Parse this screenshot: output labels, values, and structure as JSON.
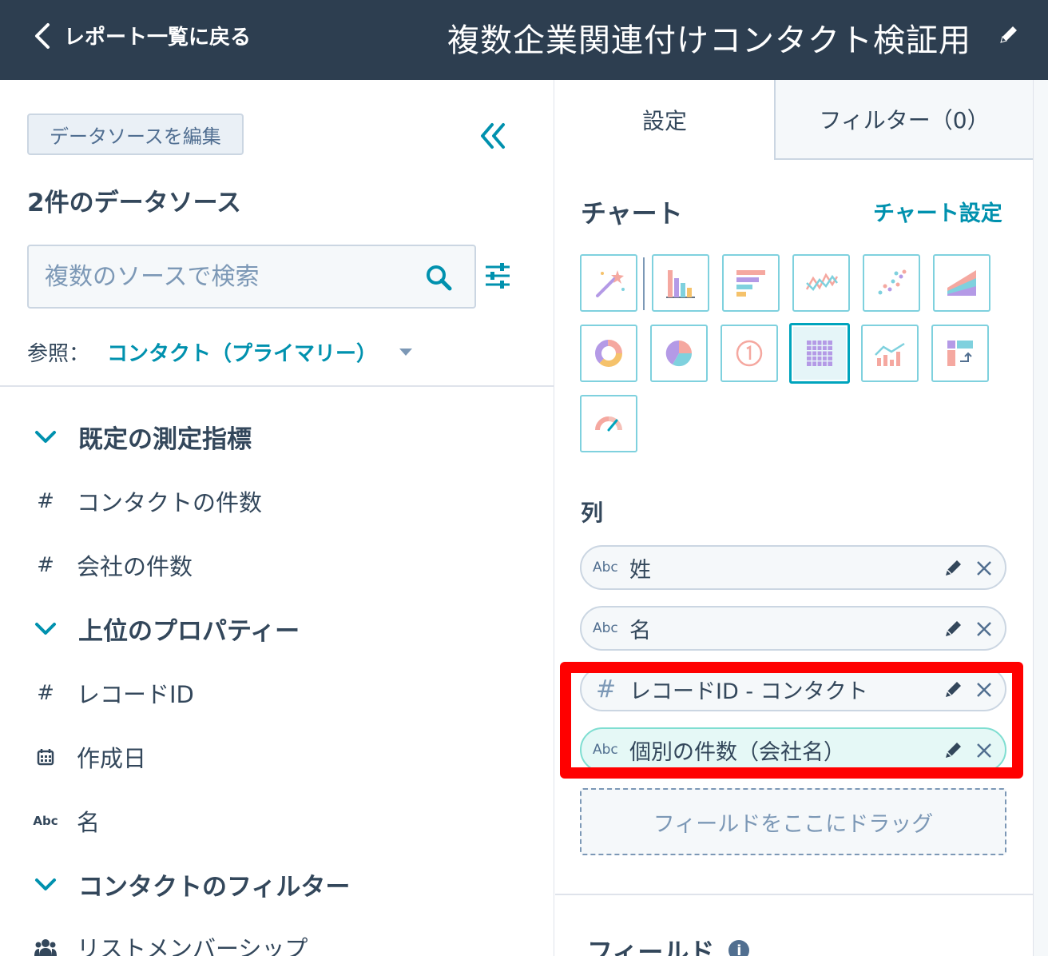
{
  "header": {
    "back_label": "レポート一覧に戻る",
    "title": "複数企業関連付けコンタクト検証用"
  },
  "left": {
    "edit_source_label": "データソースを編集",
    "sources_heading": "2件のデータソース",
    "search_placeholder": "複数のソースで検索",
    "ref_label": "参照：",
    "ref_value": "コンタクト（プライマリー）",
    "sections": [
      {
        "title": "既定の測定指標",
        "items": [
          {
            "type": "#",
            "label": "コンタクトの件数"
          },
          {
            "type": "#",
            "label": "会社の件数"
          }
        ]
      },
      {
        "title": "上位のプロパティー",
        "items": [
          {
            "type": "#",
            "label": "レコードID"
          },
          {
            "type": "calendar",
            "label": "作成日"
          },
          {
            "type": "Abc",
            "label": "名"
          }
        ]
      },
      {
        "title": "コンタクトのフィルター",
        "items": [
          {
            "type": "people",
            "label": "リストメンバーシップ"
          }
        ]
      }
    ]
  },
  "right": {
    "tabs": [
      {
        "label": "設定",
        "active": true
      },
      {
        "label": "フィルター（0）",
        "active": false
      }
    ],
    "chart_heading": "チャート",
    "chart_settings_label": "チャート設定",
    "chart_types": [
      "magic-wand",
      "vertical-bar",
      "horizontal-bar",
      "line",
      "scatter",
      "area",
      "donut",
      "pie",
      "kpi",
      "table",
      "combination",
      "pivot",
      "gauge"
    ],
    "selected_chart_type": "table",
    "columns_heading": "列",
    "columns": [
      {
        "type": "Abc",
        "label": "姓"
      },
      {
        "type": "Abc",
        "label": "名"
      },
      {
        "type": "#",
        "label": "レコードID - コンタクト"
      },
      {
        "type": "Abc",
        "label": "個別の件数（会社名）"
      }
    ],
    "dropzone_label": "フィールドをここにドラッグ",
    "fields_heading": "フィールド",
    "info_glyph": "i"
  },
  "colors": {
    "header_bg": "#2d3e50",
    "accent": "#0091ae",
    "highlight": "#ff0000"
  }
}
